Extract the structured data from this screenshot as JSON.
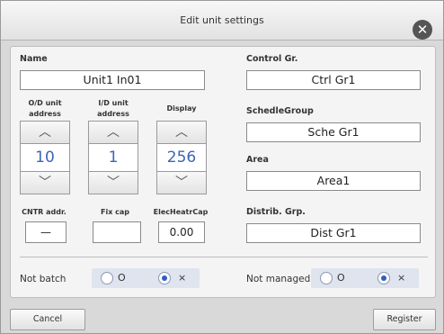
{
  "dialog": {
    "title": "Edit unit settings",
    "close_symbol": "✕"
  },
  "left": {
    "name_label": "Name",
    "name_value": "Unit1 In01",
    "od_label": "O/D unit\naddress",
    "id_label": "I/D unit\naddress",
    "display_label": "Display",
    "od_value": "10",
    "id_value": "1",
    "display_value": "256",
    "up_symbol": "︿",
    "down_symbol": "﹀",
    "cntr_label": "CNTR addr.",
    "cntr_value": "—",
    "fixcap_label": "Fix cap",
    "fixcap_value": "",
    "elecheatr_label": "ElecHeatrCap",
    "elecheatr_value": "0.00"
  },
  "right": {
    "control_label": "Control Gr.",
    "control_value": "Ctrl Gr1",
    "schedule_label": "SchedleGroup",
    "schedule_value": "Sche Gr1",
    "area_label": "Area",
    "area_value": "Area1",
    "distrib_label": "Distrib. Grp.",
    "distrib_value": "Dist Gr1"
  },
  "options": {
    "not_batch_label": "Not batch",
    "not_managed_label": "Not managed",
    "option_o": "O",
    "option_x": "×",
    "not_batch_selected": "×",
    "not_managed_selected": "×"
  },
  "footer": {
    "cancel_label": "Cancel",
    "register_label": "Register"
  },
  "colors": {
    "accent": "#3d65b8",
    "radio_bg": "#dfe4ef"
  },
  "icons": {
    "close": "close-icon",
    "up": "chevron-up-icon",
    "down": "chevron-down-icon"
  }
}
